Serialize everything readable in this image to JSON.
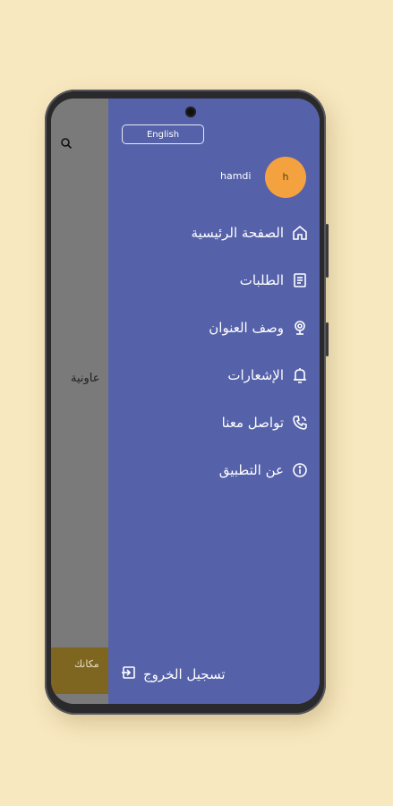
{
  "drawer": {
    "language_button": "English",
    "user": {
      "name": "hamdi",
      "avatar_initial": "h"
    },
    "menu": [
      {
        "label": "الصفحة الرئيسية",
        "icon": "home-icon"
      },
      {
        "label": "الطلبات",
        "icon": "orders-icon"
      },
      {
        "label": "وصف العنوان",
        "icon": "location-icon"
      },
      {
        "label": "الإشعارات",
        "icon": "bell-icon"
      },
      {
        "label": "تواصل معنا",
        "icon": "phone-icon"
      },
      {
        "label": "عن التطبيق",
        "icon": "info-icon"
      }
    ],
    "logout_label": "تسجيل الخروج"
  },
  "background_app": {
    "partial_text": "عاونية",
    "bottom_bar_text": "مكانك"
  },
  "colors": {
    "drawer_bg": "#5561a9",
    "avatar_bg": "#f4a23f",
    "page_bg": "#f8e8bf"
  }
}
